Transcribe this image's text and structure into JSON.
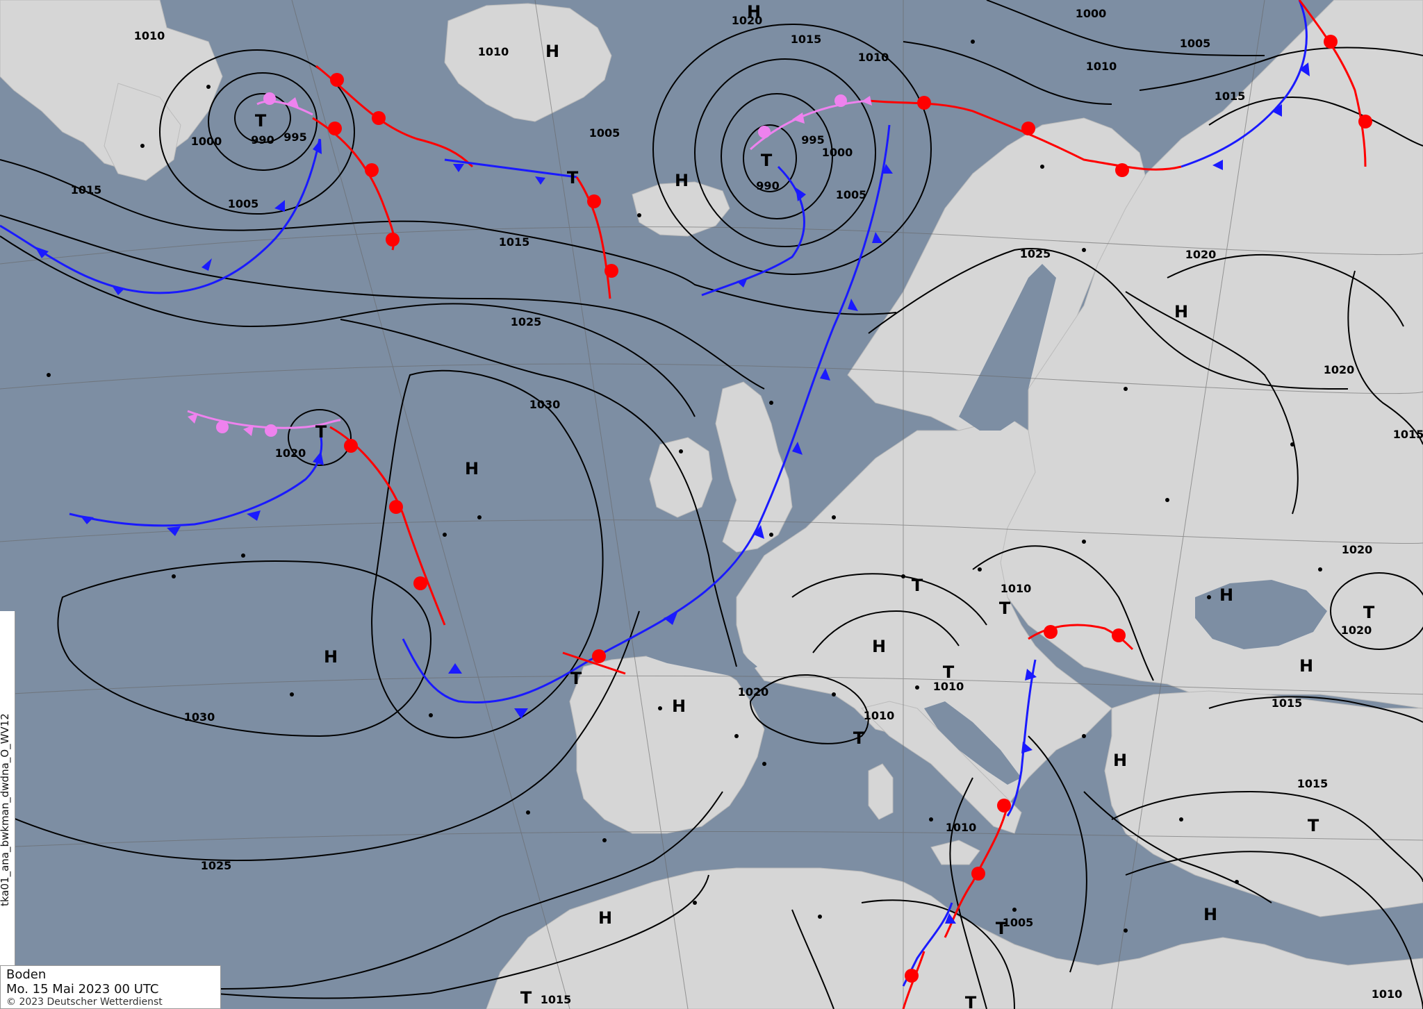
{
  "caption": {
    "level": "Boden",
    "datetime": "Mo. 15 Mai 2023 00 UTC",
    "copyright": "© 2023 Deutscher Wetterdienst"
  },
  "side_label": "tka01_ana_bwkman_dwdna_O_WV12",
  "colors": {
    "sea": "#7d8ea3",
    "land": "#d9d9d9",
    "isobar": "#000000",
    "warm_front": "#ff0000",
    "cold_front": "#1a1aff",
    "occluded_front": "#ee82ee"
  },
  "isobar_labels": [
    "1010",
    "1010",
    "1020",
    "1015",
    "1010",
    "1000",
    "1005",
    "1010",
    "1005",
    "1015",
    "990",
    "995",
    "1000",
    "1005",
    "1015",
    "990",
    "995",
    "1000",
    "1005",
    "1015",
    "1025",
    "1030",
    "1020",
    "1020",
    "1025",
    "1030",
    "1025",
    "1020",
    "1015",
    "1020",
    "1020",
    "1010",
    "1010",
    "1010",
    "1010",
    "1005",
    "1015",
    "1020",
    "1015",
    "1010",
    "1015"
  ],
  "pressure_centers": [
    {
      "type": "H",
      "label": "H"
    },
    {
      "type": "H",
      "label": "H"
    },
    {
      "type": "H",
      "label": "H"
    },
    {
      "type": "T",
      "label": "T"
    },
    {
      "type": "T",
      "label": "T"
    },
    {
      "type": "T",
      "label": "T"
    },
    {
      "type": "T",
      "label": "T"
    },
    {
      "type": "H",
      "label": "H"
    },
    {
      "type": "H",
      "label": "H"
    },
    {
      "type": "H",
      "label": "H"
    },
    {
      "type": "T",
      "label": "T"
    },
    {
      "type": "H",
      "label": "H"
    },
    {
      "type": "T",
      "label": "T"
    },
    {
      "type": "T",
      "label": "T"
    },
    {
      "type": "H",
      "label": "H"
    },
    {
      "type": "H",
      "label": "H"
    },
    {
      "type": "H",
      "label": "H"
    },
    {
      "type": "H",
      "label": "H"
    },
    {
      "type": "T",
      "label": "T"
    },
    {
      "type": "H",
      "label": "H"
    },
    {
      "type": "T",
      "label": "T"
    },
    {
      "type": "T",
      "label": "T"
    },
    {
      "type": "T",
      "label": "T"
    },
    {
      "type": "T",
      "label": "T"
    },
    {
      "type": "T",
      "label": "T"
    },
    {
      "type": "H",
      "label": "H"
    },
    {
      "type": "T",
      "label": "T"
    },
    {
      "type": "H",
      "label": "H"
    }
  ]
}
